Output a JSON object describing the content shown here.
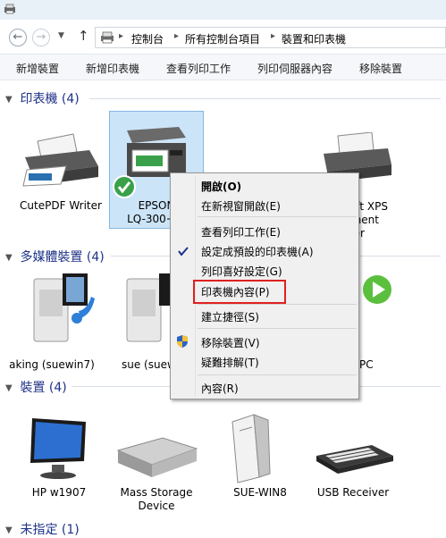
{
  "address": {
    "crumbs": [
      "控制台",
      "所有控制台項目",
      "裝置和印表機"
    ]
  },
  "toolbar": {
    "items": [
      "新增裝置",
      "新增印表機",
      "查看列印工作",
      "列印伺服器內容",
      "移除裝置"
    ]
  },
  "groups": {
    "printers": "印表機 (4)",
    "multimedia": "多媒體裝置 (4)",
    "devices": "裝置 (4)",
    "unspecified": "未指定 (1)"
  },
  "printers": [
    {
      "label": "CutePDF Writer"
    },
    {
      "label1": "EPSON",
      "label2": "LQ-300+中"
    },
    {
      "label": ""
    },
    {
      "label1": "ft XPS",
      "label2": "ment",
      "label3": "er"
    }
  ],
  "multimedia": [
    {
      "label": "aking (suewin7)"
    },
    {
      "label": "sue (suew"
    },
    {
      "label": "PC"
    }
  ],
  "devices": [
    {
      "label": "HP w1907"
    },
    {
      "label1": "Mass Storage",
      "label2": "Device"
    },
    {
      "label": "SUE-WIN8"
    },
    {
      "label": "USB Receiver"
    }
  ],
  "context_menu": {
    "items": [
      "開啟(O)",
      "在新視窗開啟(E)",
      "查看列印工作(E)",
      "設定成預設的印表機(A)",
      "列印喜好設定(G)",
      "印表機內容(P)",
      "建立捷徑(S)",
      "移除裝置(V)",
      "疑難排解(T)",
      "內容(R)"
    ]
  },
  "colors": {
    "group_header": "#1e3287",
    "selection": "#cce4f7",
    "highlight_box": "#e02020"
  }
}
